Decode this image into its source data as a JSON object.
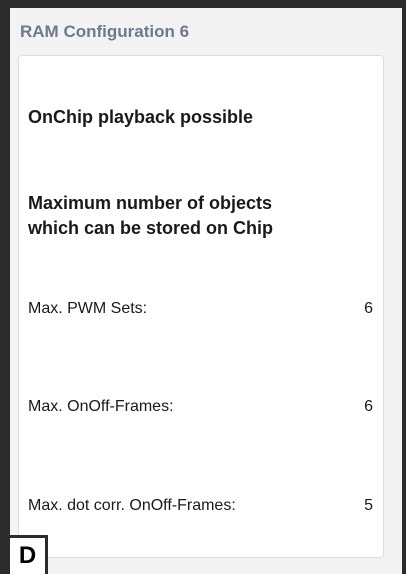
{
  "group": {
    "title": "RAM Configuration 6"
  },
  "content": {
    "onchip_text": "OnChip playback possible",
    "max_objects_line1": "Maximum number of objects",
    "max_objects_line2": "which can be stored on Chip"
  },
  "rows": [
    {
      "label": "Max. PWM Sets:",
      "value": "6"
    },
    {
      "label": "Max. OnOff-Frames:",
      "value": "6"
    },
    {
      "label": "Max. dot corr. OnOff-Frames:",
      "value": "5"
    }
  ],
  "badge": {
    "letter": "D"
  }
}
